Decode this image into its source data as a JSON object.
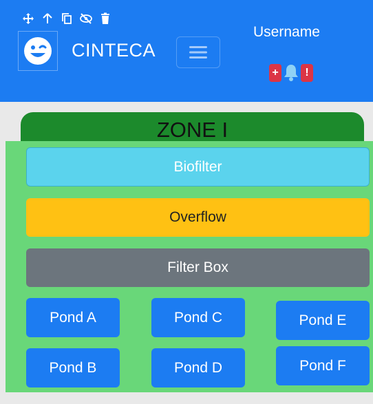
{
  "app": {
    "brand": "CINTECA"
  },
  "header": {
    "username": "Username",
    "badge_left": "+",
    "badge_right": "!"
  },
  "icons": [
    "move-icon",
    "arrow-up-icon",
    "copy-icon",
    "eye-off-icon",
    "trash-icon",
    "wink-face-icon",
    "hamburger-icon",
    "bell-icon"
  ],
  "zone": {
    "title": "ZONE I",
    "sections": [
      "Biofilter",
      "Overflow",
      "Filter Box"
    ],
    "ponds": [
      "Pond A",
      "Pond B",
      "Pond C",
      "Pond D",
      "Pond E",
      "Pond F"
    ]
  },
  "colors": {
    "header": "#1c7cf2",
    "zone_tab": "#1c8a2c",
    "zone_body": "#69d779",
    "biofilter": "#5bd3ed",
    "overflow": "#ffc113",
    "filter_box": "#6c757d",
    "pond": "#1c7cf2",
    "badge": "#dc3545"
  }
}
